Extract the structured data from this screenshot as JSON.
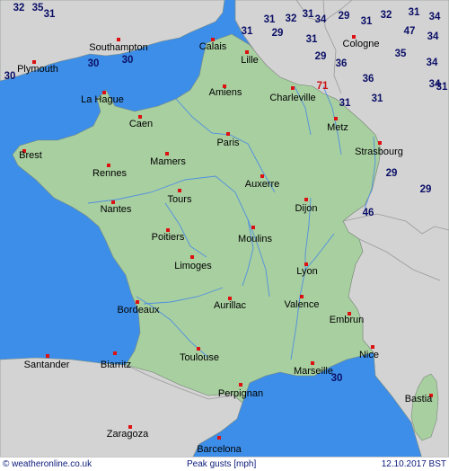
{
  "map": {
    "title": "Peak gusts [mph]",
    "date": "12.10.2017 BST",
    "copyright": "© weatheronline.co.uk",
    "colors": {
      "sea": "#3d8ee8",
      "france": "#a8cfa0",
      "neighbors": "#d3d3d3",
      "city_marker": "#dd1111",
      "value_text": "#0b0f66",
      "alert_value": "#cc1111"
    }
  },
  "cities": [
    {
      "name": "Southampton"
    },
    {
      "name": "Calais"
    },
    {
      "name": "Plymouth"
    },
    {
      "name": "Lille"
    },
    {
      "name": "Cologne"
    },
    {
      "name": "La Hague"
    },
    {
      "name": "Amiens"
    },
    {
      "name": "Charleville"
    },
    {
      "name": "Caen"
    },
    {
      "name": "Brest"
    },
    {
      "name": "Paris"
    },
    {
      "name": "Metz"
    },
    {
      "name": "Strasbourg"
    },
    {
      "name": "Mamers"
    },
    {
      "name": "Rennes"
    },
    {
      "name": "Auxerre"
    },
    {
      "name": "Tours"
    },
    {
      "name": "Nantes"
    },
    {
      "name": "Dijon"
    },
    {
      "name": "Poitiers"
    },
    {
      "name": "Moulins"
    },
    {
      "name": "Limoges"
    },
    {
      "name": "Lyon"
    },
    {
      "name": "Aurillac"
    },
    {
      "name": "Valence"
    },
    {
      "name": "Bordeaux"
    },
    {
      "name": "Embrun"
    },
    {
      "name": "Toulouse"
    },
    {
      "name": "Nice"
    },
    {
      "name": "Santander"
    },
    {
      "name": "Biarritz"
    },
    {
      "name": "Marseille"
    },
    {
      "name": "Perpignan"
    },
    {
      "name": "Bastia"
    },
    {
      "name": "Zaragoza"
    },
    {
      "name": "Barcelona"
    }
  ],
  "gusts": [
    {
      "value": "32"
    },
    {
      "value": "35"
    },
    {
      "value": "31"
    },
    {
      "value": "31"
    },
    {
      "value": "32"
    },
    {
      "value": "31"
    },
    {
      "value": "34"
    },
    {
      "value": "29"
    },
    {
      "value": "31"
    },
    {
      "value": "32"
    },
    {
      "value": "31"
    },
    {
      "value": "34"
    },
    {
      "value": "31"
    },
    {
      "value": "29"
    },
    {
      "value": "31"
    },
    {
      "value": "47"
    },
    {
      "value": "34"
    },
    {
      "value": "30"
    },
    {
      "value": "30"
    },
    {
      "value": "30"
    },
    {
      "value": "29"
    },
    {
      "value": "36"
    },
    {
      "value": "35"
    },
    {
      "value": "34"
    },
    {
      "value": "36"
    },
    {
      "value": "34"
    },
    {
      "value": "71",
      "alert": true
    },
    {
      "value": "31"
    },
    {
      "value": "31"
    },
    {
      "value": "31"
    },
    {
      "value": "29"
    },
    {
      "value": "29"
    },
    {
      "value": "46"
    },
    {
      "value": "30"
    }
  ]
}
